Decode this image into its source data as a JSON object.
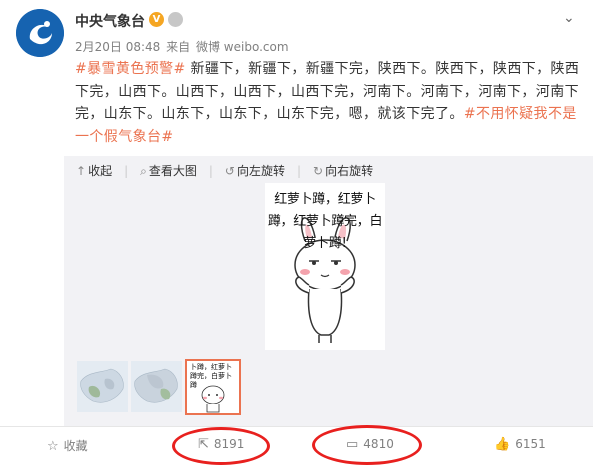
{
  "post": {
    "username": "中央气象台",
    "verified_badge": "V",
    "date": "2月20日 08:48",
    "source_prefix": "来自",
    "source": "微博 weibo.com",
    "topic_tag": "#暴雪黄色预警#",
    "body": " 新疆下，新疆下，新疆下完，陕西下。陕西下，陕西下，陕西下完，山西下。山西下，山西下，山西下完，河南下。河南下，河南下，河南下完，山东下。山东下，山东下，山东下完，嗯，就该下完了。",
    "end_tag": "#不用怀疑我不是一个假气象台#"
  },
  "toolbar": {
    "collapse": "收起",
    "view_large": "查看大图",
    "rotate_left": "向左旋转",
    "rotate_right": "向右旋转"
  },
  "image": {
    "caption": "红萝卜蹲，红萝卜蹲，红萝卜蹲完，白萝卜蹲!",
    "thumb_caption": "卜蹲，红萝卜蹲完，白萝卜蹲"
  },
  "footer": {
    "favorite": "收藏",
    "reposts": "8191",
    "comments": "4810",
    "likes": "6151"
  },
  "colors": {
    "tag": "#eb7350",
    "annotation": "#e8201e",
    "avatar": "#1663b0"
  },
  "icons": {
    "verified": "verified-badge-icon",
    "member": "member-icon",
    "menu": "chevron-down-icon",
    "collapse": "arrow-up-icon",
    "view_large": "magnify-icon",
    "rotate_left": "rotate-left-icon",
    "rotate_right": "rotate-right-icon",
    "favorite": "star-icon",
    "repost": "share-icon",
    "comment": "comment-icon",
    "like": "thumbs-up-icon"
  }
}
